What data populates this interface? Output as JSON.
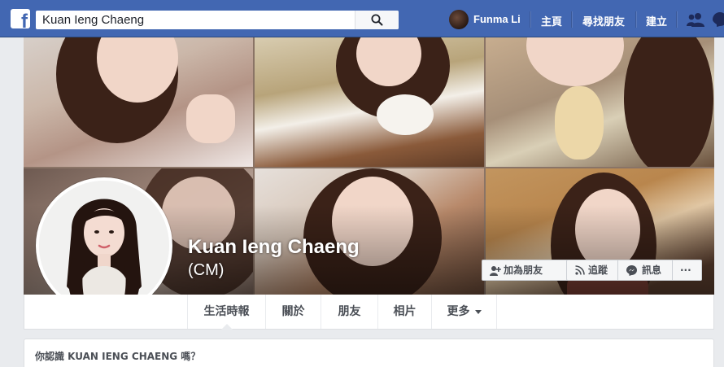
{
  "search": {
    "value": "Kuan Ieng Chaeng"
  },
  "nav": {
    "username": "Funma Li",
    "home": "主頁",
    "find_friends": "尋找朋友",
    "create": "建立"
  },
  "profile": {
    "name": "Kuan Ieng Chaeng",
    "alternate_name": "(CM)"
  },
  "actions": {
    "add_friend": "加為朋友",
    "follow": "追蹤",
    "message": "訊息",
    "more": "···"
  },
  "tabs": [
    {
      "label": "生活時報",
      "active": true
    },
    {
      "label": "關於"
    },
    {
      "label": "朋友"
    },
    {
      "label": "相片"
    },
    {
      "label": "更多"
    }
  ],
  "know_card": {
    "text": "你認識 KUAN IENG CHAENG 嗎？"
  },
  "colors": {
    "brand_blue": "#4267b2",
    "page_bg": "#e9ebee",
    "button_text": "#4b4f56"
  }
}
